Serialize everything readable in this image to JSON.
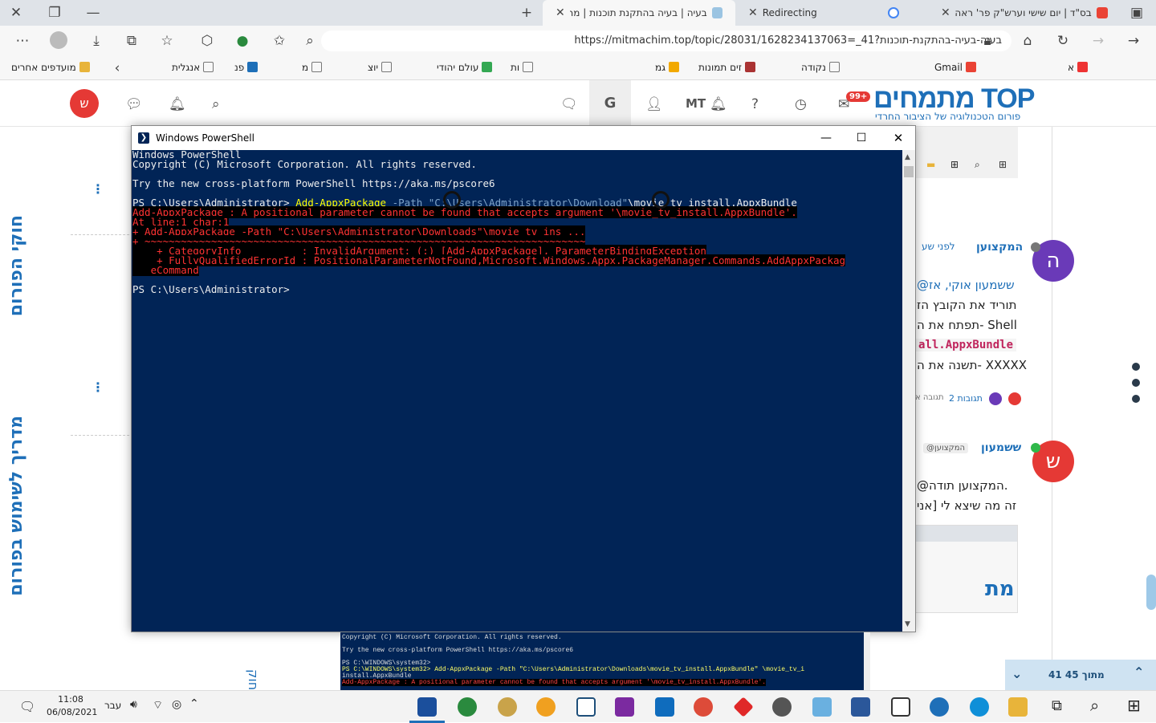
{
  "tabs": [
    {
      "label": "בס\"ד | יום שישי וערש\"ק פר' ראה",
      "active": false
    },
    {
      "label": "Redirecting",
      "active": false
    },
    {
      "label": "בעיה | בעיה בהתקנת תוכנות | מר",
      "active": true
    }
  ],
  "address": {
    "url": "https://mitmachim.top/topic/28031/1628234137063=_בעיה-בעיה-בהתקנת-תוכנות?41"
  },
  "bookmarks": [
    "Gmail",
    "נקודה",
    "זים תמונות",
    "גמ",
    "ות",
    "עולם יהודי",
    "יוצ",
    "מ",
    "פנ",
    "אנגלית",
    "מועדפים אחרים",
    "א"
  ],
  "site": {
    "logo_title": "מתמחים TOP",
    "logo_subtitle": "פורום הטכנולוגיה של הציבור החרדי",
    "notif_count": "99+",
    "header_initials": "MT",
    "user_avatar": "ש"
  },
  "sidebar": {
    "vertical_1": "חוקי הפורום",
    "vertical_2": "מדריך לשימוש בפורום"
  },
  "posts": [
    {
      "author": "המקצוען",
      "avatar": "ה",
      "time": "לפני שע",
      "lines": [
        "@ששמעון אוקי, אז",
        "תוריד את הקובץ הז",
        "תפתח את ה- Shell",
        "all.AppxBundle",
        "תשנה את ה- XXXXX"
      ],
      "replies": "2 תגובות",
      "reply_link": "תגובה א"
    },
    {
      "author": "ששמעון",
      "avatar": "ש",
      "reply_to": "@המקצוען",
      "lines": [
        "@המקצוען תודה.",
        "זה מה שיצא לי [אני"
      ]
    }
  ],
  "powershell": {
    "title": "Windows PowerShell",
    "lines": [
      {
        "t": "Windows PowerShell",
        "c": "n"
      },
      {
        "t": "Copyright (C) Microsoft Corporation. All rights reserved.",
        "c": "n"
      },
      {
        "t": "",
        "c": "n"
      },
      {
        "t": "Try the new cross-platform PowerShell https://aka.ms/pscore6",
        "c": "n"
      },
      {
        "t": "",
        "c": "n"
      },
      {
        "t": "PS C:\\Users\\Administrator> ",
        "c": "cmd"
      },
      {
        "t": "Add-AppxPackage : A positional parameter cannot be found that accepts argument '\\movie_tv_install.AppxBundle'.",
        "c": "e"
      },
      {
        "t": "At line:1 char:1",
        "c": "e"
      },
      {
        "t": "+ Add-AppxPackage -Path \"C:\\Users\\Administrator\\Downloads\"\\movie_tv_ins ...",
        "c": "e"
      },
      {
        "t": "+ ~~~~~~~~~~~~~~~~~~~~~~~~~~~~~~~~~~~~~~~~~~~~~~~~~~~~~~~~~~~~~~~~~~~~~~~~~",
        "c": "e"
      },
      {
        "t": "    + CategoryInfo          : InvalidArgument: (:) [Add-AppxPackage], ParameterBindingException",
        "c": "e"
      },
      {
        "t": "    + FullyQualifiedErrorId : PositionalParameterNotFound,Microsoft.Windows.Appx.PackageManager.Commands.AddAppxPackag",
        "c": "e"
      },
      {
        "t": "   eCommand",
        "c": "e"
      },
      {
        "t": "",
        "c": "n"
      },
      {
        "t": "PS C:\\Users\\Administrator>",
        "c": "n"
      }
    ],
    "cmd_name": "Add-AppxPackage",
    "cmd_param": " -Path ",
    "cmd_path": "\"C:\\Users\\Administrator\\Download\"",
    "cmd_tail": "\\movie_tv_install.AppxBundle"
  },
  "bg_terminal": [
    "Copyright (C) Microsoft Corporation. All rights reserved.",
    "Try the new cross-platform PowerShell https://aka.ms/pscore6",
    "PS C:\\WINDOWS\\system32>",
    "PS C:\\WINDOWS\\system32> Add-AppxPackage -Path \"C:\\Users\\Administrator\\Downloads\\movie_tv_install.AppxBundle\" \\movie_tv_i",
    "install.AppxBundle",
    "Add-AppxPackage : A positional parameter cannot be found that accepts argument '\\movie_tv_install.AppxBundle'."
  ],
  "pager": {
    "text": "41 מתוך 45"
  },
  "taskbar": {
    "time": "11:08",
    "date": "06/08/2021",
    "lang": "עבר"
  }
}
